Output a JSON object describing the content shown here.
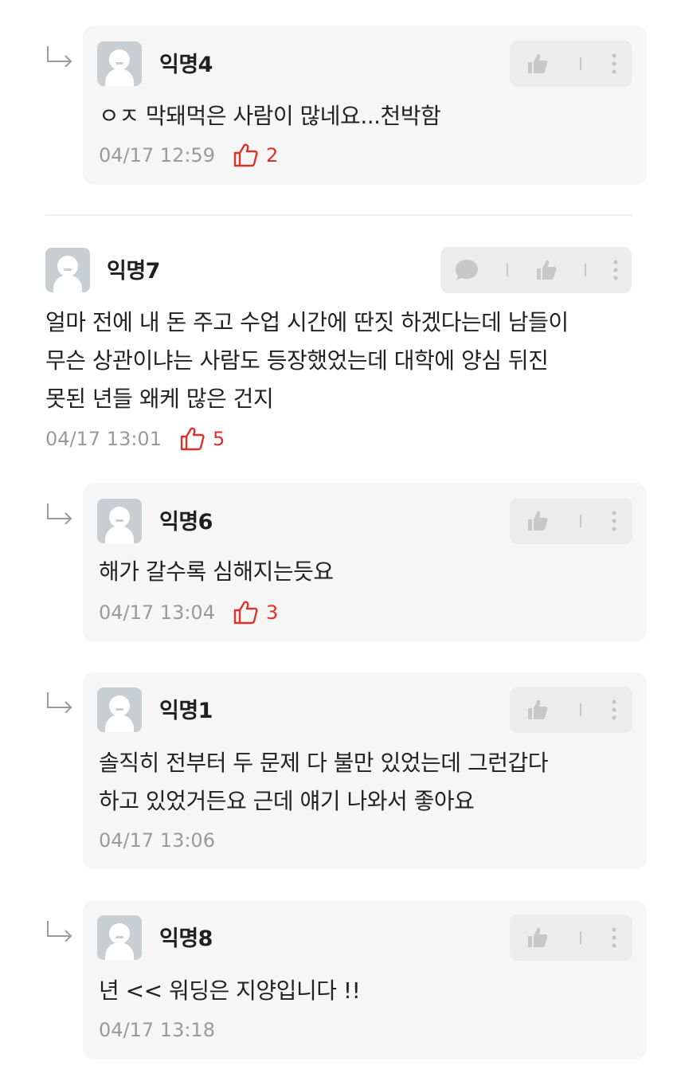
{
  "comments": [
    {
      "nick": "익명4",
      "text": [
        "ㅇㅈ 막돼먹은 사람이 많네요...천박함"
      ],
      "time": "04/17 12:59",
      "likes": "2"
    },
    {
      "nick": "익명7",
      "text": [
        "얼마 전에 내 돈 주고 수업 시간에 딴짓 하겠다는데 남들이",
        "무슨 상관이냐는 사람도 등장했었는데 대학에 양심 뒤진",
        "못된 년들 왜케 많은 건지"
      ],
      "time": "04/17 13:01",
      "likes": "5"
    },
    {
      "nick": "익명6",
      "text": [
        "해가 갈수록 심해지는듯요"
      ],
      "time": "04/17 13:04",
      "likes": "3"
    },
    {
      "nick": "익명1",
      "text": [
        "솔직히 전부터 두 문제 다 불만 있었는데 그런갑다",
        "하고 있었거든요 근데 얘기 나와서 좋아요"
      ],
      "time": "04/17 13:06"
    },
    {
      "nick": "익명8",
      "text": [
        "년 << 워딩은 지양입니다 !!"
      ],
      "time": "04/17 13:18"
    }
  ],
  "icons": {
    "like": "thumbs-up-icon",
    "more": "more-vertical-icon",
    "reply": "reply-icon",
    "liked": "thumbs-up-outline-icon",
    "arrow": "reply-arrow-icon"
  },
  "colors": {
    "likes": "#e0302a",
    "card": "#f6f6f6",
    "meta": "#9a9a9a"
  }
}
